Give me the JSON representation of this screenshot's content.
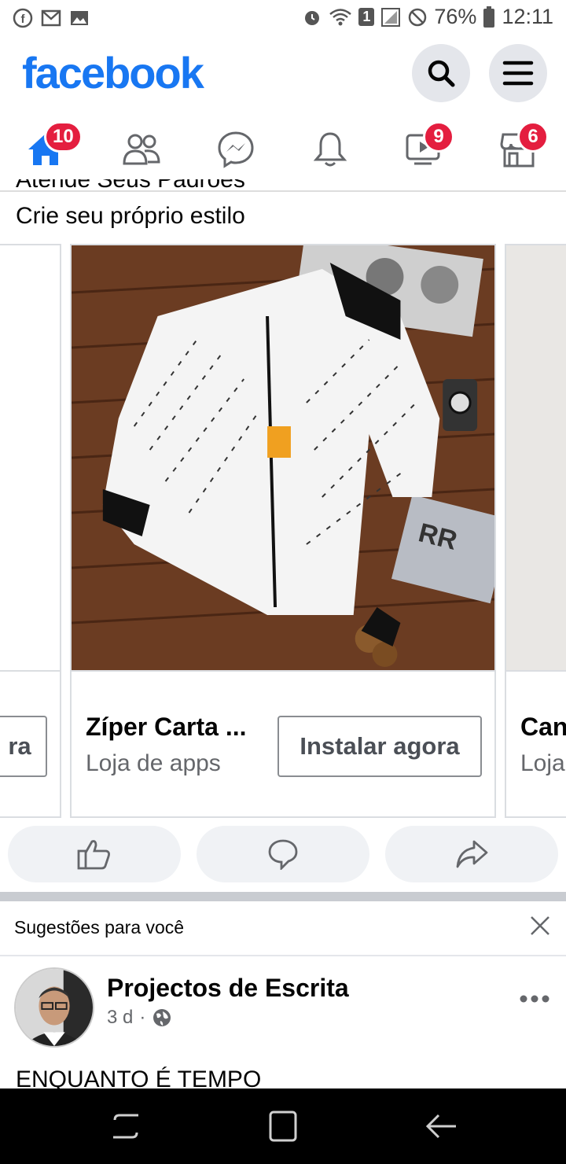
{
  "status_bar": {
    "battery": "76%",
    "time": "12:11",
    "sim_badge": "1"
  },
  "header": {
    "logo": "facebook"
  },
  "nav": {
    "home_badge": "10",
    "watch_badge": "9",
    "marketplace_badge": "6"
  },
  "ad": {
    "title_partial": "Atende Seus Padrões",
    "text": "Crie seu próprio estilo",
    "cards": [
      {
        "cta": "ra"
      },
      {
        "title": "Zíper Carta ...",
        "subtitle": "Loja de apps",
        "cta": "Instalar agora"
      },
      {
        "title": "Can",
        "subtitle": "Loja"
      }
    ]
  },
  "suggestions": {
    "label": "Sugestões para você"
  },
  "post": {
    "author": "Projectos de Escrita",
    "time": "3 d",
    "separator": "·",
    "text": "ENQUANTO É TEMPO"
  },
  "colors": {
    "brand": "#1877f2",
    "badge": "#e41e3f",
    "secondary_text": "#65676b"
  }
}
